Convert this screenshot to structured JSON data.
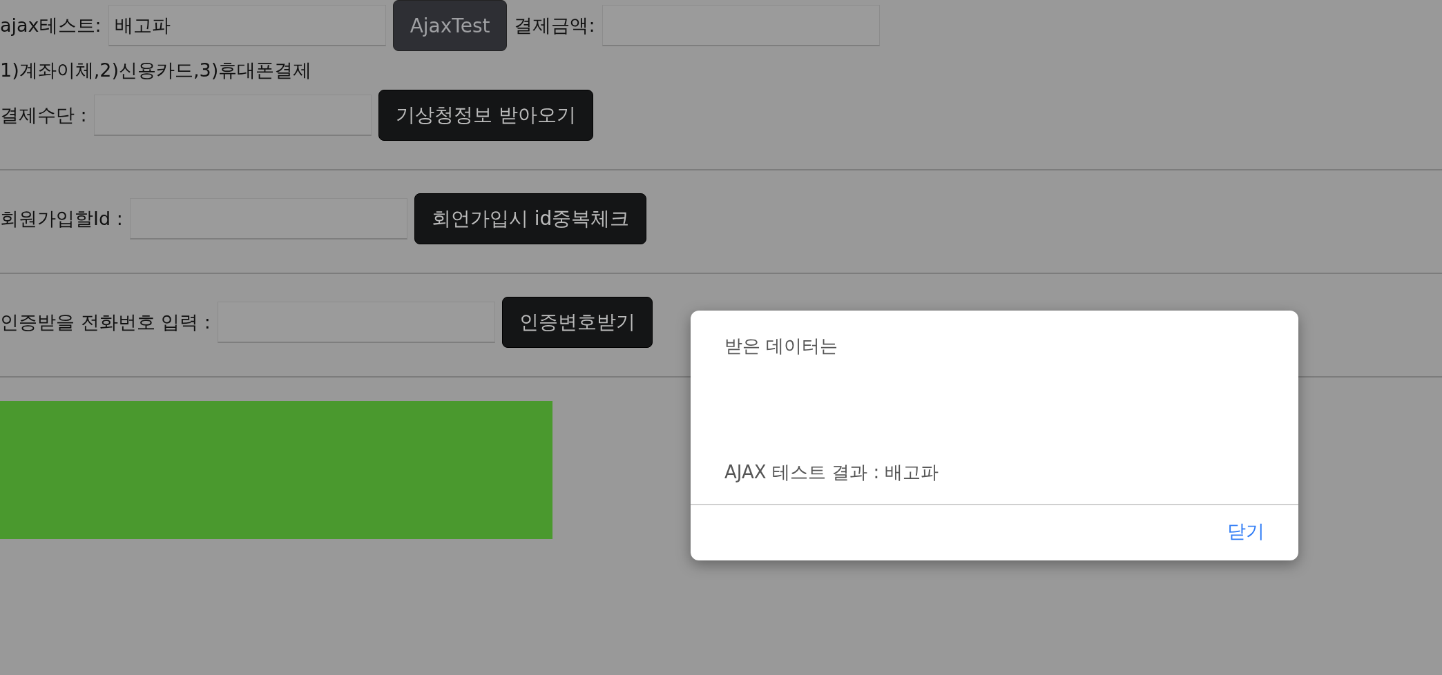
{
  "sections": [
    {
      "rows": [
        {
          "items": [
            {
              "kind": "label",
              "text": "ajax테스트:"
            },
            {
              "kind": "input",
              "value": "배고파"
            },
            {
              "kind": "button",
              "text": "AjaxTest",
              "disabled": true
            },
            {
              "kind": "label",
              "text": "결제금액:"
            },
            {
              "kind": "input",
              "value": ""
            }
          ]
        },
        {
          "items": [
            {
              "kind": "label",
              "text": "1)계좌이체,2)신용카드,3)휴대폰결제"
            }
          ]
        },
        {
          "items": [
            {
              "kind": "label",
              "text": "결제수단 :"
            },
            {
              "kind": "input",
              "value": ""
            },
            {
              "kind": "button",
              "text": "기상청정보 받아오기",
              "disabled": false
            }
          ]
        }
      ]
    },
    {
      "rows": [
        {
          "items": [
            {
              "kind": "label",
              "text": "회원가입할Id :"
            },
            {
              "kind": "input",
              "value": ""
            },
            {
              "kind": "button",
              "text": "회언가입시 id중복체크",
              "disabled": false
            }
          ]
        }
      ]
    },
    {
      "rows": [
        {
          "items": [
            {
              "kind": "label",
              "text": "인증받을 전화번호 입력 :"
            },
            {
              "kind": "input",
              "value": ""
            },
            {
              "kind": "button",
              "text": "인증변호받기",
              "disabled": false
            }
          ]
        }
      ]
    }
  ],
  "dialog": {
    "message_lines": [
      "받은 데이터는",
      "AJAX 테스트 결과 : 배고파"
    ],
    "buttons": [
      "닫기"
    ]
  }
}
